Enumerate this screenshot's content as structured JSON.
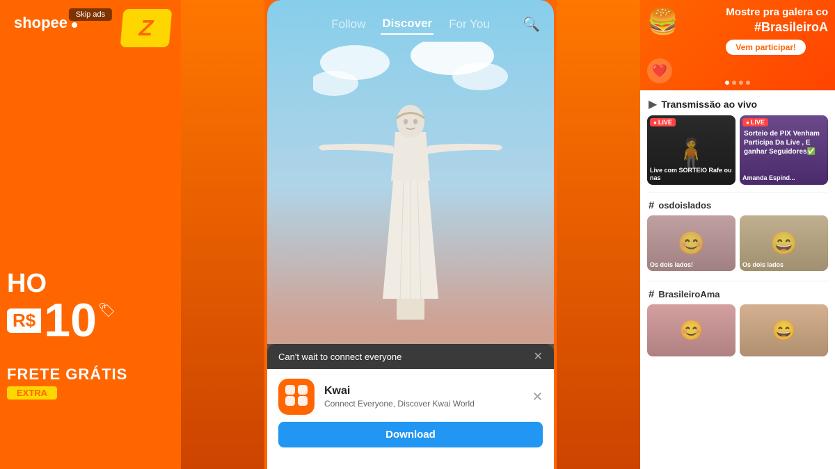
{
  "left_panel": {
    "logo": "shopee",
    "skip_ads": "Skip ads",
    "tv_channel": "Z",
    "price_prefix": "HO",
    "price_label": "R$",
    "price_value": "10",
    "frete": "FRETE GRÁTIS",
    "extra": "EXTRA"
  },
  "phone": {
    "nav": {
      "follow": "Follow",
      "discover": "Discover",
      "for_you": "For You"
    },
    "popup": {
      "cant_wait": "Can't wait to connect everyone",
      "app_name": "Kwai",
      "app_desc": "Connect Everyone, Discover Kwai World",
      "download": "Download"
    }
  },
  "right_panel": {
    "banner": {
      "text": "Mostre pra galera co",
      "hashtag": "#BrasileiroA",
      "btn": "Vem participar!"
    },
    "live_section": {
      "icon": "▶",
      "title": "Transmissão ao vivo",
      "cards": [
        {
          "badge": "LIVE",
          "label": "Live com SORTEIO\nRafe ou nas"
        },
        {
          "badge": "LIVE",
          "overlay": "Sorteio de PIX\nVenham Participa Da Live , E ganhar Seguidores✅",
          "label": "Amanda Espínd..."
        }
      ]
    },
    "osdoislados": {
      "hashtag": "osdoislados",
      "cards": [
        {
          "label": "Os dois lados!"
        },
        {
          "label": "Os dois lados"
        }
      ]
    },
    "brasileiroama": {
      "hashtag": "BrasileiroAma",
      "cards": [
        {},
        {}
      ]
    }
  }
}
